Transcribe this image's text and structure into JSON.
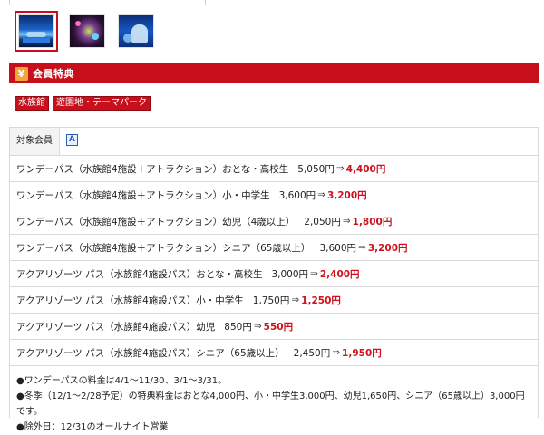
{
  "gallery": {
    "thumbnails": [
      {
        "name": "aquarium-light-show-thumbnail",
        "selected": true
      },
      {
        "name": "neon-attraction-thumbnail",
        "selected": false
      },
      {
        "name": "blue-projection-thumbnail",
        "selected": false
      }
    ]
  },
  "section": {
    "icon": "yen-icon",
    "icon_glyph": "¥",
    "title": "会員特典"
  },
  "tags": [
    "水族館",
    "遊園地・テーマパーク"
  ],
  "panel": {
    "tab_label": "対象会員",
    "rank_badge": "A",
    "rows": [
      {
        "plan": "ワンデーパス（水族館4施設＋アトラクション）おとな・高校生",
        "original": "5,050円",
        "arrow": "⇒",
        "discount": "4,400円"
      },
      {
        "plan": "ワンデーパス（水族館4施設＋アトラクション）小・中学生",
        "original": "3,600円",
        "arrow": "⇒",
        "discount": "3,200円"
      },
      {
        "plan": "ワンデーパス（水族館4施設＋アトラクション）幼児（4歳以上）",
        "original": "2,050円",
        "arrow": "⇒",
        "discount": "1,800円"
      },
      {
        "plan": "ワンデーパス（水族館4施設＋アトラクション）シニア（65歳以上）",
        "original": "3,600円",
        "arrow": "⇒",
        "discount": "3,200円"
      },
      {
        "plan": "アクアリゾーツ パス（水族館4施設パス）おとな・高校生",
        "original": "3,000円",
        "arrow": "⇒",
        "discount": "2,400円"
      },
      {
        "plan": "アクアリゾーツ パス（水族館4施設パス）小・中学生",
        "original": "1,750円",
        "arrow": "⇒",
        "discount": "1,250円"
      },
      {
        "plan": "アクアリゾーツ パス（水族館4施設パス）幼児",
        "original": "850円",
        "arrow": "⇒",
        "discount": "550円"
      },
      {
        "plan": "アクアリゾーツ パス（水族館4施設パス）シニア（65歳以上）",
        "original": "2,450円",
        "arrow": "⇒",
        "discount": "1,950円"
      }
    ],
    "notes": [
      "●ワンデーパスの料金は4/1～11/30、3/1～3/31。",
      "●冬季（12/1～2/28予定）の特典料金はおとな4,000円、小・中学生3,000円、幼児1,650円、シニア（65歳以上）3,000円です。",
      "●除外日：12/31のオールナイト営業"
    ]
  },
  "colors": {
    "accent_red": "#c8101d",
    "discount_red": "#d0101d",
    "yen_badge": "#f2a63a",
    "rank_blue": "#2a5db8"
  }
}
